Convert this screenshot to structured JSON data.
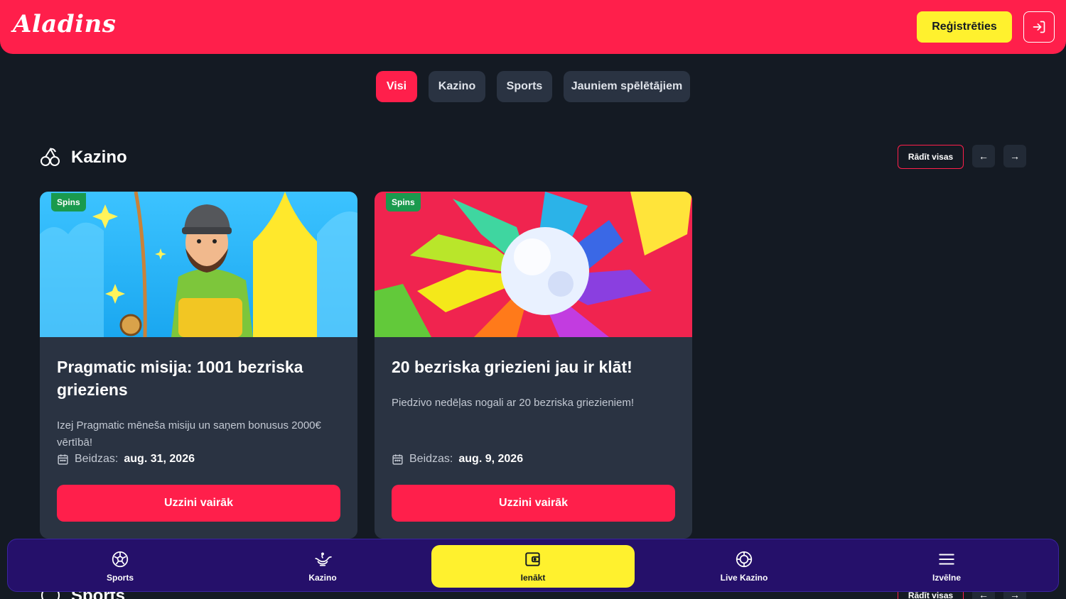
{
  "header": {
    "logo": "Aladins",
    "register_label": "Reģistrēties"
  },
  "filters": [
    {
      "label": "Visi",
      "active": true
    },
    {
      "label": "Kazino",
      "active": false
    },
    {
      "label": "Sports",
      "active": false
    },
    {
      "label": "Jauniem spēlētājiem",
      "active": false
    }
  ],
  "section": {
    "title": "Kazino",
    "show_all": "Rādīt visas"
  },
  "cards": [
    {
      "tag": "Spins",
      "title": "Pragmatic misija: 1001 bezriska grieziens",
      "description": "Izej Pragmatic mēneša misiju un saņem bonusus 2000€ vērtībā!",
      "expiry_label": "Beidzas:",
      "expiry_date": "aug. 31, 2026",
      "button": "Uzzini vairāk"
    },
    {
      "tag": "Spins",
      "title": "20 bezriska griezieni jau ir klāt!",
      "description": "Piedzivo nedēļas nogali ar 20 bezriska griezieniem!",
      "expiry_label": "Beidzas:",
      "expiry_date": "aug. 9, 2026",
      "button": "Uzzini vairāk"
    }
  ],
  "next_section": {
    "title": "Sports",
    "show_all": "Rādīt visas"
  },
  "bottom_nav": [
    {
      "label": "Sports",
      "icon": "soccer-ball-icon"
    },
    {
      "label": "Kazino",
      "icon": "genie-lamp-icon"
    },
    {
      "label": "Ienākt",
      "icon": "wallet-icon",
      "active": true
    },
    {
      "label": "Live Kazino",
      "icon": "casino-chip-icon"
    },
    {
      "label": "Izvēlne",
      "icon": "menu-icon"
    }
  ],
  "colors": {
    "brand_red": "#ff1f4b",
    "brand_yellow": "#fff12e",
    "background": "#141a23",
    "card": "#2a3342",
    "nav": "#25106a"
  }
}
